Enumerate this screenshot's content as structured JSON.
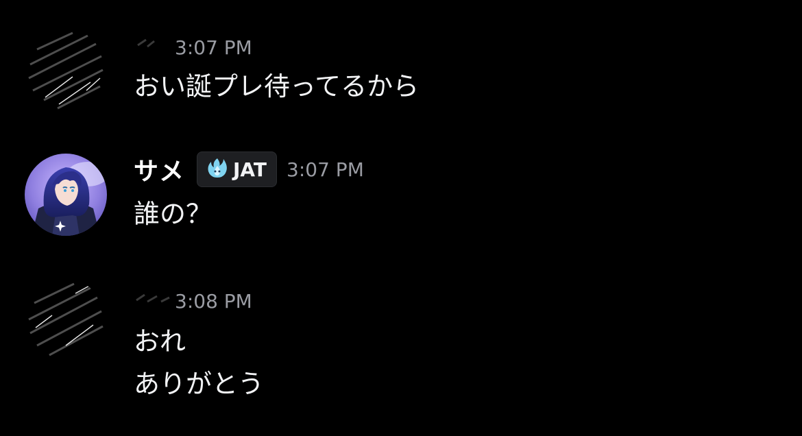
{
  "messages": [
    {
      "author": "",
      "author_tag": "",
      "timestamp": "3:07 PM",
      "lines": [
        "おい誕プレ待ってるから"
      ]
    },
    {
      "author": "サメ",
      "author_tag": "JAT",
      "timestamp": "3:07 PM",
      "lines": [
        "誰の？"
      ]
    },
    {
      "author": "",
      "author_tag": "",
      "timestamp": "3:08 PM",
      "lines": [
        "おれ",
        "ありがとう"
      ]
    }
  ],
  "colors": {
    "background": "#000000",
    "text": "#f2f3f5",
    "timestamp": "#9a9ca3",
    "tag_background": "#1e1f22",
    "tag_icon": "#7fd3f0"
  },
  "icons": {
    "tag_icon": "flame-icon"
  }
}
